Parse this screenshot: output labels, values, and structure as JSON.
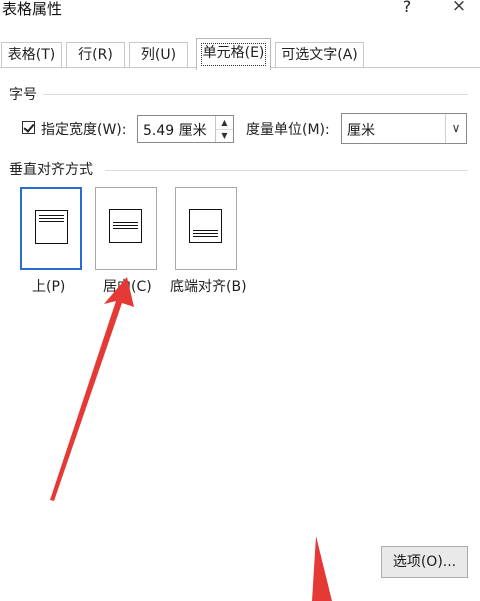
{
  "window": {
    "title": "表格属性",
    "help": "?",
    "close": "×"
  },
  "tabs": [
    {
      "label": "表格(T)",
      "active": false
    },
    {
      "label": "行(R)",
      "active": false
    },
    {
      "label": "列(U)",
      "active": false
    },
    {
      "label": "单元格(E)",
      "active": true
    },
    {
      "label": "可选文字(A)",
      "active": false
    }
  ],
  "size_group": {
    "label": "字号",
    "preferred_width_checkbox": {
      "label": "指定宽度(W):",
      "checked": true
    },
    "width_value": "5.49 厘米",
    "measure_label": "度量单位(M):",
    "measure_value": "厘米"
  },
  "vertical_alignment": {
    "label": "垂直对齐方式",
    "options": [
      {
        "label": "上(P)",
        "selected": true
      },
      {
        "label": "居中(C)",
        "selected": false
      },
      {
        "label": "底端对齐(B)",
        "selected": false
      }
    ]
  },
  "options_button": "选项(O)...",
  "annotation_color": "#e53935"
}
